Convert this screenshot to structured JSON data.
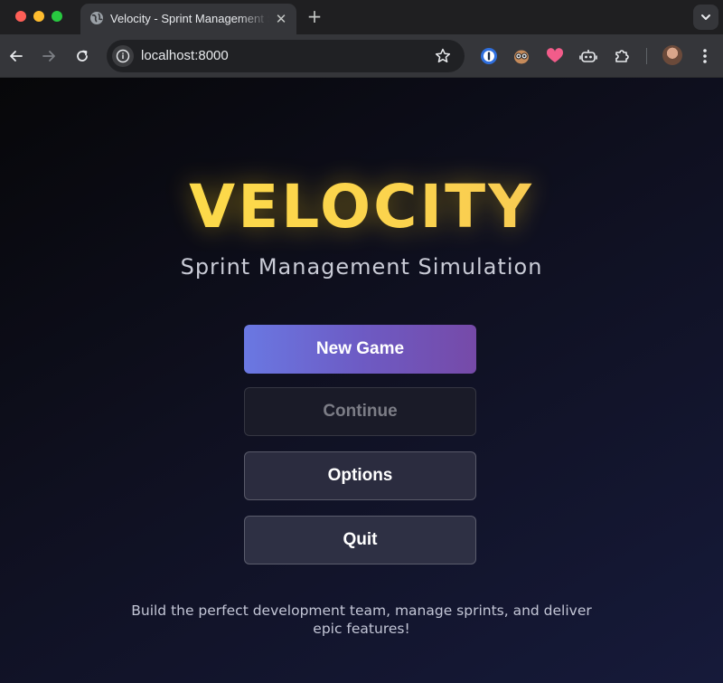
{
  "browser": {
    "tab": {
      "title": "Velocity - Sprint Management Simulation",
      "favicon": "globe-icon",
      "close_label": "✕"
    },
    "new_tab_label": "+",
    "address_bar": {
      "url": "localhost:8000"
    },
    "icons": {
      "back": "back-arrow-icon",
      "forward": "forward-arrow-icon",
      "reload": "reload-icon",
      "site_info": "info-icon",
      "bookmark": "star-icon",
      "extensions": [
        "password-manager-icon",
        "owl-extension-icon",
        "heart-extension-icon",
        "robot-extension-icon",
        "puzzle-icon"
      ],
      "menu": "more-vertical-icon"
    }
  },
  "game": {
    "title": "VELOCITY",
    "subtitle": "Sprint Management Simulation",
    "menu": {
      "new_game": "New Game",
      "continue": "Continue",
      "options": "Options",
      "quit": "Quit"
    },
    "tagline": "Build the perfect development team, manage sprints, and deliver epic features!",
    "colors": {
      "title_gold": "#fde047",
      "primary_start": "#6a78e2",
      "primary_end": "#764aa8",
      "background_dark": "#070709",
      "background_navy": "#161a3a"
    }
  }
}
